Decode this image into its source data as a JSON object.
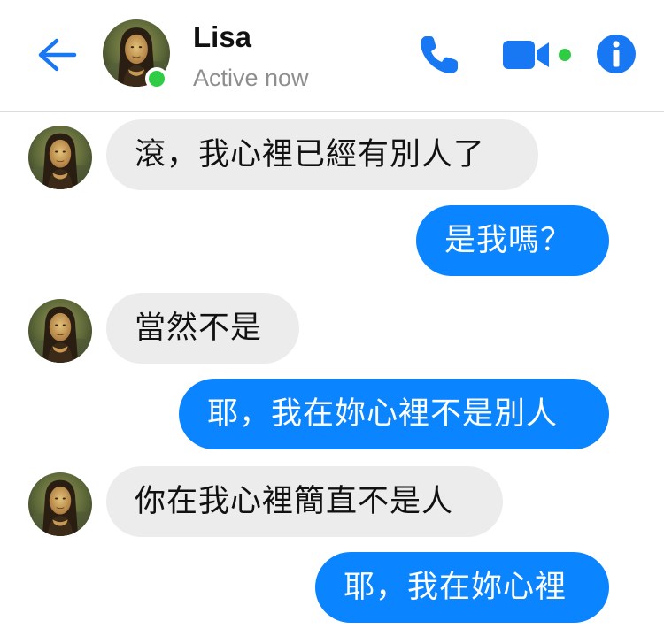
{
  "header": {
    "contact_name": "Lisa",
    "status": "Active now",
    "presence": "online",
    "icons": {
      "back": "back-arrow-icon",
      "call": "phone-icon",
      "video": "video-camera-icon",
      "info": "info-icon"
    }
  },
  "colors": {
    "accent": "#0a84ff",
    "incoming_bubble": "#ececec",
    "presence_green": "#31cc46"
  },
  "messages": [
    {
      "direction": "incoming",
      "text": "滾，我心裡已經有別人了"
    },
    {
      "direction": "outgoing",
      "text": "是我嗎？"
    },
    {
      "direction": "incoming",
      "text": "當然不是"
    },
    {
      "direction": "outgoing",
      "text": "耶，我在妳心裡不是別人"
    },
    {
      "direction": "incoming",
      "text": "你在我心裡簡直不是人"
    },
    {
      "direction": "outgoing",
      "text": "耶，我在妳心裡"
    }
  ]
}
